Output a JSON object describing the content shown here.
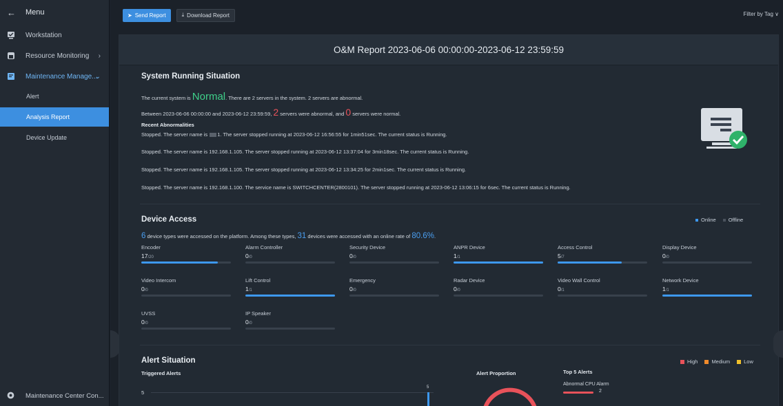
{
  "sidebar": {
    "menu_label": "Menu",
    "items": [
      {
        "label": "Workstation"
      },
      {
        "label": "Resource Monitoring"
      },
      {
        "label": "Maintenance Manage..."
      }
    ],
    "sub_items": [
      {
        "label": "Alert"
      },
      {
        "label": "Analysis Report"
      },
      {
        "label": "Device Update"
      }
    ],
    "footer_label": "Maintenance Center Con..."
  },
  "toolbar": {
    "send_label": "Send Report",
    "download_label": "Download Report",
    "filter_label": "Filter by Tag"
  },
  "report": {
    "title": "O&M Report 2023-06-06 00:00:00-2023-06-12 23:59:59",
    "system": {
      "title": "System Running Situation",
      "line1_pre": "The current system is ",
      "line1_status": "Normal",
      "line1_post": ". There are 2 servers in the system. 2 servers are abnormal.",
      "line2_pre": "Between 2023-06-06 00:00:00 and 2023-06-12 23:59:59, ",
      "line2_abnormal": "2",
      "line2_mid": " servers were abnormal, and ",
      "line2_normal": "0",
      "line2_post": " servers were normal.",
      "recent_label": "Recent Abnormalities",
      "ab1_pre": "Stopped. The server name is ",
      "ab1_post": "1. The server stopped running at 2023-06-12 16:56:55 for 1min51sec. The current status is Running.",
      "ab2": "Stopped. The server name is 192.168.1.105. The server stopped running at 2023-06-12 13:37:04 for 3min18sec. The current status is Running.",
      "ab3": "Stopped. The server name is 192.168.1.105. The server stopped running at 2023-06-12 13:34:25 for 2min1sec. The current status is Running.",
      "ab4": "Stopped. The server name is 192.168.1.100. The service name is SWITCHCENTER(2800101). The server stopped running at 2023-06-12 13:06:15 for 6sec. The current status is Running."
    },
    "device": {
      "title": "Device Access",
      "legend_online": "Online",
      "legend_offline": "Offline",
      "summary_types": "6",
      "summary_mid": " device types were accessed on the platform. Among these types, ",
      "summary_count": "31",
      "summary_mid2": " devices were accessed with an online rate of ",
      "summary_rate": "80.6%",
      "summary_end": ".",
      "cells": [
        {
          "name": "Encoder",
          "online": "17",
          "total": "/20",
          "ratio": 0.85
        },
        {
          "name": "Alarm Controller",
          "online": "0",
          "total": "/0",
          "ratio": 0
        },
        {
          "name": "Security Device",
          "online": "0",
          "total": "/0",
          "ratio": 0
        },
        {
          "name": "ANPR Device",
          "online": "1",
          "total": "/1",
          "ratio": 1
        },
        {
          "name": "Access Control",
          "online": "5",
          "total": "/7",
          "ratio": 0.714
        },
        {
          "name": "Display Device",
          "online": "0",
          "total": "/0",
          "ratio": 0
        },
        {
          "name": "Video Intercom",
          "online": "0",
          "total": "/0",
          "ratio": 0
        },
        {
          "name": "Lift Control",
          "online": "1",
          "total": "/1",
          "ratio": 1
        },
        {
          "name": "Emergency",
          "online": "0",
          "total": "/0",
          "ratio": 0
        },
        {
          "name": "Radar Device",
          "online": "0",
          "total": "/0",
          "ratio": 0
        },
        {
          "name": "Video Wall Control",
          "online": "0",
          "total": "/1",
          "ratio": 0
        },
        {
          "name": "Network Device",
          "online": "1",
          "total": "/1",
          "ratio": 1
        },
        {
          "name": "UVSS",
          "online": "0",
          "total": "/0",
          "ratio": 0
        },
        {
          "name": "IP Speaker",
          "online": "0",
          "total": "/0",
          "ratio": 0
        }
      ]
    },
    "alert": {
      "title": "Alert Situation",
      "triggered_label": "Triggered Alerts",
      "y_tick": "5",
      "bar_value": "5",
      "proportion_label": "Alert Proportion",
      "top5_label": "Top 5 Alerts",
      "top1_name": "Abnormal CPU Alarm",
      "top1_count": "2",
      "legend_high": "High",
      "legend_medium": "Medium",
      "legend_low": "Low"
    }
  },
  "colors": {
    "accent": "#3d8fe0",
    "normal": "#3fd08a",
    "abnormal": "#e8525a",
    "high": "#e8525a",
    "medium": "#f08a2b",
    "low": "#f0c02b"
  }
}
